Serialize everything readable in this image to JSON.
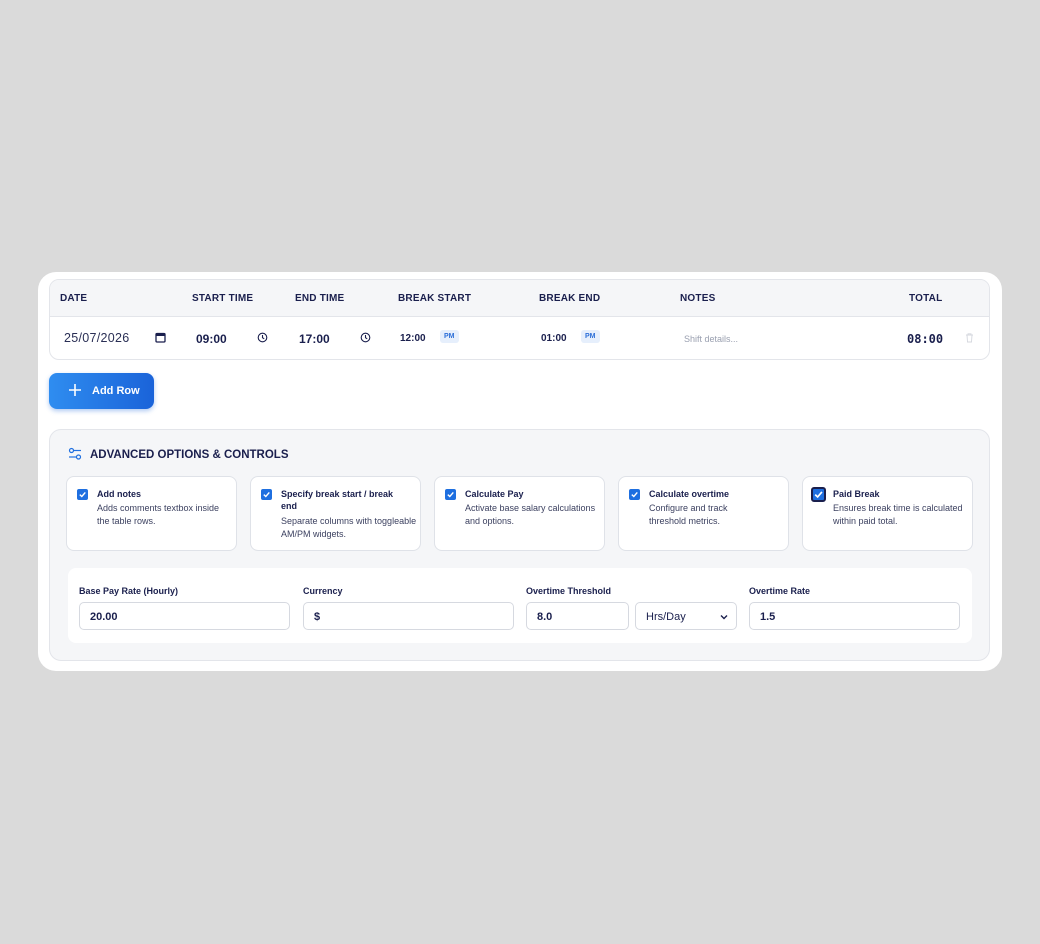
{
  "table": {
    "headers": {
      "date": "DATE",
      "start_time": "START TIME",
      "end_time": "END TIME",
      "break_start": "BREAK START",
      "break_end": "BREAK END",
      "notes": "NOTES",
      "total": "TOTAL"
    },
    "row": {
      "date": "25/07/2026",
      "start_time": "09:00",
      "end_time": "17:00",
      "break_start": "12:00",
      "break_start_ampm": "PM",
      "break_end": "01:00",
      "break_end_ampm": "PM",
      "notes_placeholder": "Shift details...",
      "total": "08:00"
    }
  },
  "add_row_label": "Add Row",
  "advanced": {
    "title": "ADVANCED OPTIONS & CONTROLS",
    "options": [
      {
        "title": "Add notes",
        "desc": "Adds comments textbox inside the table rows.",
        "checked": true
      },
      {
        "title": "Specify break start / break end",
        "desc": "Separate columns with toggleable AM/PM widgets.",
        "checked": true
      },
      {
        "title": "Calculate Pay",
        "desc": "Activate base salary calculations and options.",
        "checked": true
      },
      {
        "title": "Calculate overtime",
        "desc": "Configure and track threshold metrics.",
        "checked": true
      },
      {
        "title": "Paid Break",
        "desc": "Ensures break time is calculated within paid total.",
        "checked": true
      }
    ]
  },
  "rates": {
    "base_pay_label": "Base Pay Rate (Hourly)",
    "base_pay_value": "20.00",
    "currency_label": "Currency",
    "currency_value": "$",
    "overtime_threshold_label": "Overtime Threshold",
    "overtime_threshold_value": "8.0",
    "overtime_unit": "Hrs/Day",
    "overtime_rate_label": "Overtime Rate",
    "overtime_rate_value": "1.5"
  },
  "colors": {
    "accent": "#1e6fe0",
    "text": "#1a1f4d",
    "background": "#dadada"
  }
}
